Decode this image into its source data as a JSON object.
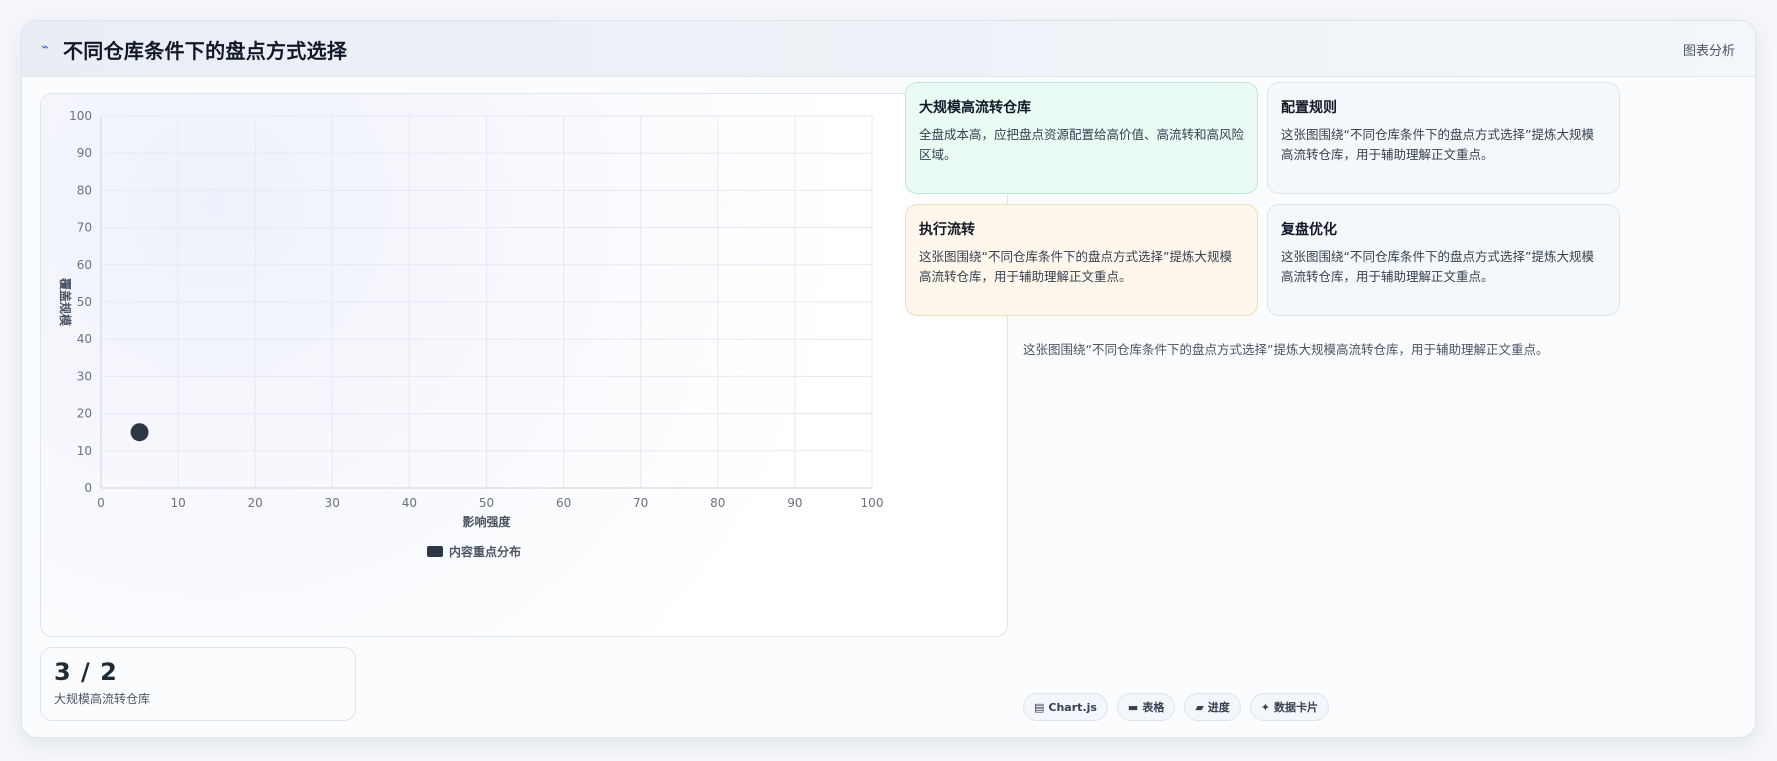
{
  "header": {
    "icon": "lightning-icon",
    "title": "不同仓库条件下的盘点方式选择",
    "action_label": "图表分析"
  },
  "chart_data": {
    "type": "scatter",
    "xlabel": "影响强度",
    "ylabel": "覆盖规模",
    "xlim": [
      0,
      100
    ],
    "ylim": [
      0,
      100
    ],
    "xticks": [
      0,
      10,
      20,
      30,
      40,
      50,
      60,
      70,
      80,
      90,
      100
    ],
    "yticks": [
      0,
      10,
      20,
      30,
      40,
      50,
      60,
      70,
      80,
      90,
      100
    ],
    "grid": true,
    "legend_position": "bottom",
    "series": [
      {
        "name": "内容重点分布",
        "color": "#2d3748",
        "points": [
          {
            "x": 5,
            "y": 15
          }
        ]
      }
    ]
  },
  "tiles": [
    {
      "title": "大规模高流转仓库",
      "text": "全盘成本高，应把盘点资源配置给高价值、高流转和高风险区域。",
      "tone": "green"
    },
    {
      "title": "配置规则",
      "text": "这张图围绕“不同仓库条件下的盘点方式选择”提炼大规模高流转仓库，用于辅助理解正文重点。",
      "tone": "plain"
    },
    {
      "title": "执行流转",
      "text": "这张图围绕“不同仓库条件下的盘点方式选择”提炼大规模高流转仓库，用于辅助理解正文重点。",
      "tone": "orange"
    },
    {
      "title": "复盘优化",
      "text": "这张图围绕“不同仓库条件下的盘点方式选择”提炼大规模高流转仓库，用于辅助理解正文重点。",
      "tone": "plain"
    }
  ],
  "note": "这张图围绕“不同仓库条件下的盘点方式选择”提炼大规模高流转仓库，用于辅助理解正文重点。",
  "stat": {
    "value": "3 / 2",
    "label": "大规模高流转仓库"
  },
  "chips": [
    {
      "icon": "chart-icon",
      "glyph": "▤",
      "label": "Chart.js"
    },
    {
      "icon": "table-icon",
      "glyph": "▬",
      "label": "表格"
    },
    {
      "icon": "progress-icon",
      "glyph": "▰",
      "label": "进度"
    },
    {
      "icon": "sparkle-icon",
      "glyph": "✦",
      "label": "数据卡片"
    }
  ]
}
